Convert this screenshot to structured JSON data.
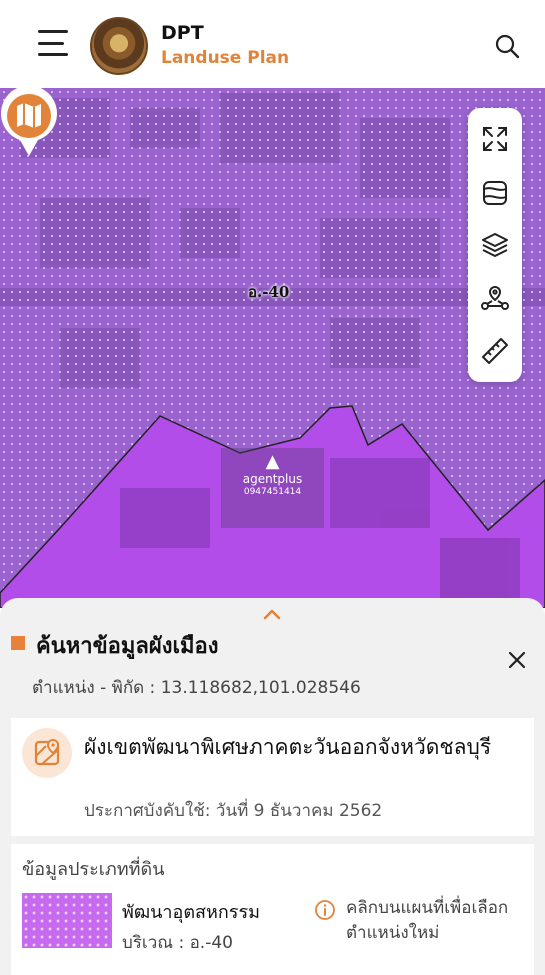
{
  "header": {
    "brand_title": "DPT",
    "brand_subtitle": "Landuse Plan",
    "menu_icon": "hamburger-menu-icon",
    "search_icon": "search-icon",
    "logo": "department-seal-logo"
  },
  "map": {
    "zone_label": "อ.-40",
    "marker_icon": "map-book-icon",
    "watermark": {
      "brand": "agentplus",
      "phone": "0947451414"
    },
    "overlay_colors": {
      "industrial": "#c66bef",
      "light_zone": "#a26ad6"
    },
    "toolbar": [
      {
        "icon": "fullscreen-expand-icon"
      },
      {
        "icon": "map-frame-icon"
      },
      {
        "icon": "layers-icon"
      },
      {
        "icon": "location-route-icon"
      },
      {
        "icon": "ruler-icon"
      }
    ]
  },
  "sheet": {
    "title": "ค้นหาข้อมูลผังเมือง",
    "coordinate_label": "ตำแหน่ง - พิกัด :",
    "coordinate_value": "13.118682,101.028546",
    "plan": {
      "icon": "map-pin-doc-icon",
      "name": "ผังเขตพัฒนาพิเศษภาคตะวันออกจังหวัดชลบุรี",
      "effective_date": "ประกาศบังคับใช้: วันที่ 9 ธันวาคม 2562"
    },
    "land": {
      "heading": "ข้อมูลประเภทที่ดิน",
      "type": "พัฒนาอุตสหกรรม",
      "area": "บริเวณ : อ.-40",
      "hint": "คลิกบนแผนที่เพื่อเลือกตำแหน่งใหม่",
      "swatch_color": "#c66bef"
    }
  }
}
